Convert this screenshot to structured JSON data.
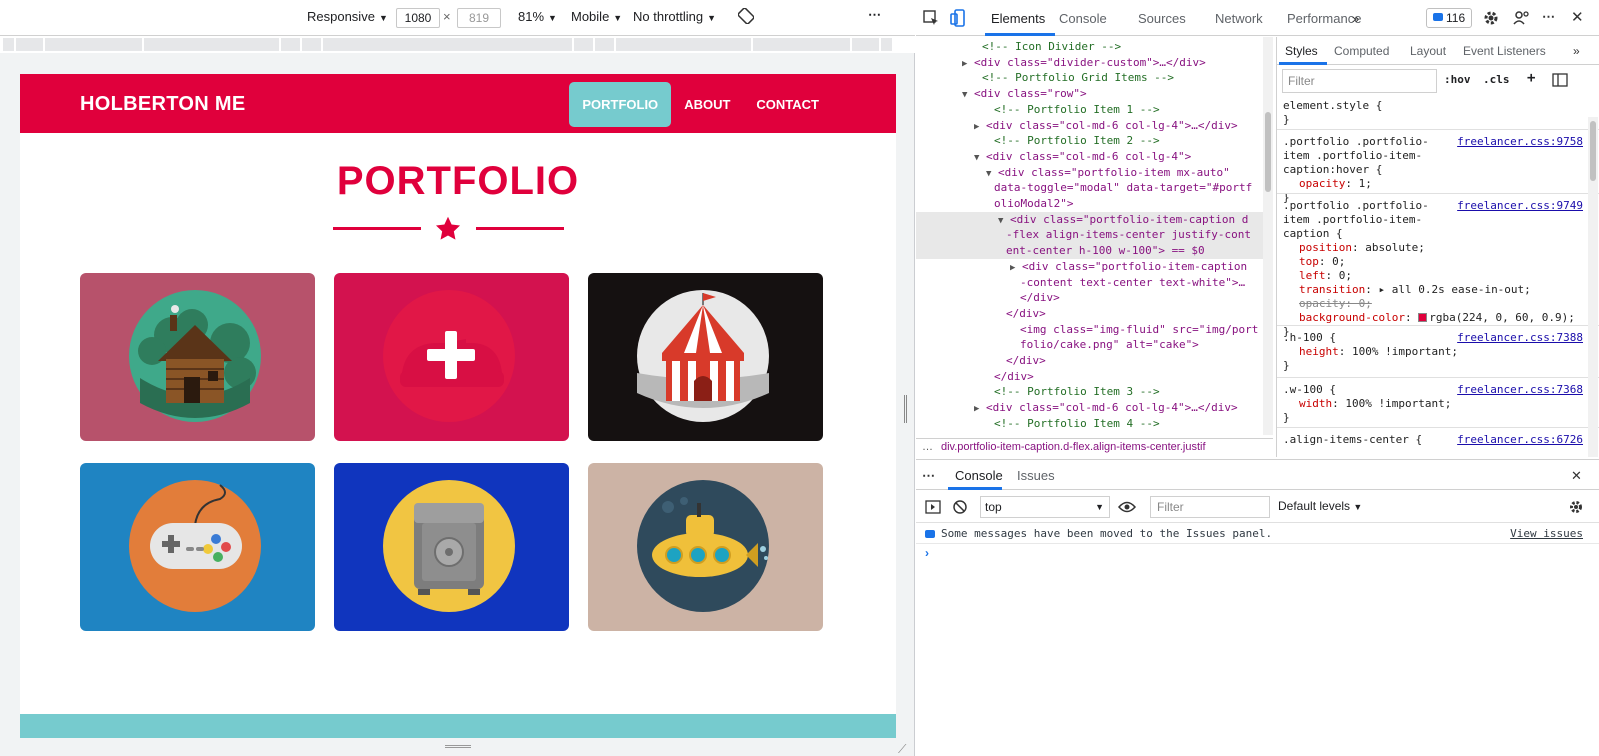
{
  "device_toolbar": {
    "device": "Responsive",
    "width": "1080",
    "height": "819",
    "zoom": "81%",
    "mode": "Mobile",
    "throttling": "No throttling"
  },
  "site": {
    "brand": "HOLBERTON ME",
    "nav": [
      "PORTFOLIO",
      "ABOUT",
      "CONTACT"
    ],
    "active_nav": "PORTFOLIO",
    "title": "PORTFOLIO",
    "accent": "#e0003c",
    "teal": "#76cbce",
    "items": [
      {
        "name": "cabin",
        "bg": "#b7526b"
      },
      {
        "name": "cake",
        "bg": "#d3124f"
      },
      {
        "name": "circus",
        "bg": "#151111"
      },
      {
        "name": "game",
        "bg": "#1f84c2"
      },
      {
        "name": "safe",
        "bg": "#1035be"
      },
      {
        "name": "submarine",
        "bg": "#ccb3a5"
      }
    ]
  },
  "devtools": {
    "tabs": [
      "Elements",
      "Console",
      "Sources",
      "Network",
      "Performance"
    ],
    "active_tab": "Elements",
    "issues_count": "116",
    "dom_lines": [
      {
        "t": "cm",
        "text": "<!-- Icon Divider -->"
      },
      {
        "t": "el",
        "text": "<div class=\"divider-custom\">…</div>"
      },
      {
        "t": "cm",
        "text": "<!-- Portfolio Grid Items -->"
      },
      {
        "t": "el",
        "text": "<div class=\"row\">"
      },
      {
        "t": "cm",
        "text": "<!-- Portfolio Item 1 -->"
      },
      {
        "t": "el",
        "text": "<div class=\"col-md-6 col-lg-4\">…</div>"
      },
      {
        "t": "cm",
        "text": "<!-- Portfolio Item 2 -->"
      },
      {
        "t": "el",
        "text": "<div class=\"col-md-6 col-lg-4\">"
      },
      {
        "t": "el",
        "text": "<div class=\"portfolio-item mx-auto\""
      },
      {
        "t": "el",
        "text": "data-toggle=\"modal\" data-target=\"#portf"
      },
      {
        "t": "el",
        "text": "olioModal2\">"
      },
      {
        "t": "el",
        "text": "<div class=\"portfolio-item-caption d"
      },
      {
        "t": "el",
        "text": "-flex align-items-center justify-cont"
      },
      {
        "t": "el",
        "text": "ent-center h-100 w-100\"> == $0"
      },
      {
        "t": "el",
        "text": "<div class=\"portfolio-item-caption"
      },
      {
        "t": "el",
        "text": "-content text-center text-white\">…"
      },
      {
        "t": "el",
        "text": "</div>"
      },
      {
        "t": "el",
        "text": "</div>"
      },
      {
        "t": "el",
        "text": "<img class=\"img-fluid\" src=\"img/port"
      },
      {
        "t": "el",
        "text": "folio/cake.png\" alt=\"cake\">"
      },
      {
        "t": "el",
        "text": "</div>"
      },
      {
        "t": "el",
        "text": "</div>"
      },
      {
        "t": "cm",
        "text": "<!-- Portfolio Item 3 -->"
      },
      {
        "t": "el",
        "text": "<div class=\"col-md-6 col-lg-4\">…</div>"
      },
      {
        "t": "cm",
        "text": "<!-- Portfolio Item 4 -->"
      }
    ],
    "breadcrumb": "div.portfolio-item-caption.d-flex.align-items-center.justif",
    "styles_tabs": [
      "Styles",
      "Computed",
      "Layout",
      "Event Listeners"
    ],
    "styles_filter_placeholder": "Filter",
    "hov": ":hov",
    "cls": ".cls",
    "rules": [
      {
        "selector": "element.style {",
        "src": "",
        "props": [],
        "close": "}"
      },
      {
        "selector": ".portfolio .portfolio-item .portfolio-item-caption:hover {",
        "src": "freelancer.css:9758",
        "props": [
          "opacity: 1;"
        ],
        "close": "}"
      },
      {
        "selector": ".portfolio .portfolio-item .portfolio-item-caption {",
        "src": "freelancer.css:9749",
        "props": [
          "position: absolute;",
          "top: 0;",
          "left: 0;",
          "transition: ▸ all 0.2s ease-in-out;",
          "opacity: 0;",
          "background-color: rgba(224, 0, 60, 0.9);"
        ],
        "close": "}"
      },
      {
        "selector": ".h-100 {",
        "src": "freelancer.css:7388",
        "props": [
          "height: 100% !important;"
        ],
        "close": "}"
      },
      {
        "selector": ".w-100 {",
        "src": "freelancer.css:7368",
        "props": [
          "width: 100% !important;"
        ],
        "close": "}"
      },
      {
        "selector": ".align-items-center {",
        "src": "freelancer.css:6726",
        "props": [],
        "close": ""
      }
    ],
    "drawer_tabs": [
      "Console",
      "Issues"
    ],
    "context": "top",
    "console_filter_placeholder": "Filter",
    "levels": "Default levels",
    "message": "Some messages have been moved to the Issues panel.",
    "view_issues": "View issues"
  }
}
